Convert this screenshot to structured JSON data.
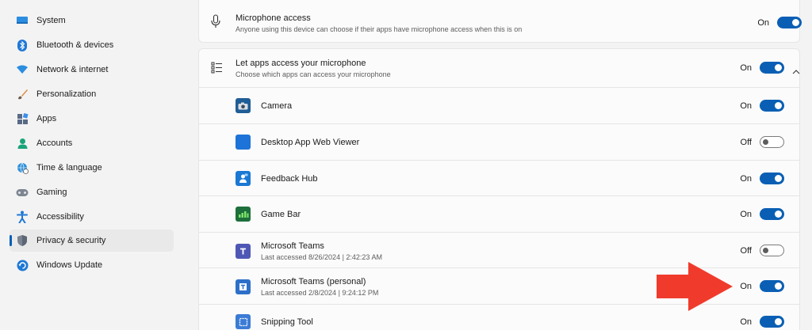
{
  "sidebar": {
    "items": [
      {
        "label": "System",
        "icon": "monitor-icon"
      },
      {
        "label": "Bluetooth & devices",
        "icon": "bluetooth-icon"
      },
      {
        "label": "Network & internet",
        "icon": "wifi-icon"
      },
      {
        "label": "Personalization",
        "icon": "brush-icon"
      },
      {
        "label": "Apps",
        "icon": "apps-icon"
      },
      {
        "label": "Accounts",
        "icon": "person-icon"
      },
      {
        "label": "Time & language",
        "icon": "globe-clock-icon"
      },
      {
        "label": "Gaming",
        "icon": "gamepad-icon"
      },
      {
        "label": "Accessibility",
        "icon": "accessibility-icon"
      },
      {
        "label": "Privacy & security",
        "icon": "shield-icon",
        "selected": true
      },
      {
        "label": "Windows Update",
        "icon": "update-icon"
      }
    ]
  },
  "mic_access": {
    "title": "Microphone access",
    "subtitle": "Anyone using this device can choose if their apps have microphone access when this is on",
    "state": "On",
    "enabled": true
  },
  "apps_access": {
    "title": "Let apps access your microphone",
    "subtitle": "Choose which apps can access your microphone",
    "state": "On",
    "enabled": true,
    "expanded": true
  },
  "apps": [
    {
      "name": "Camera",
      "sub": "",
      "state": "On",
      "enabled": true,
      "icon": "camera-app-icon"
    },
    {
      "name": "Desktop App Web Viewer",
      "sub": "",
      "state": "Off",
      "enabled": false,
      "icon": "web-viewer-app-icon"
    },
    {
      "name": "Feedback Hub",
      "sub": "",
      "state": "On",
      "enabled": true,
      "icon": "feedback-hub-app-icon"
    },
    {
      "name": "Game Bar",
      "sub": "",
      "state": "On",
      "enabled": true,
      "icon": "game-bar-app-icon"
    },
    {
      "name": "Microsoft Teams",
      "sub": "Last accessed 8/26/2024  |  2:42:23 AM",
      "state": "Off",
      "enabled": false,
      "icon": "teams-app-icon"
    },
    {
      "name": "Microsoft Teams (personal)",
      "sub": "Last accessed 2/8/2024  |  9:24:12 PM",
      "state": "On",
      "enabled": true,
      "icon": "teams-personal-app-icon"
    },
    {
      "name": "Snipping Tool",
      "sub": "",
      "state": "On",
      "enabled": true,
      "icon": "snipping-tool-app-icon"
    }
  ],
  "colors": {
    "accent": "#0a5fb4",
    "annotation_arrow": "#f03b2c"
  }
}
